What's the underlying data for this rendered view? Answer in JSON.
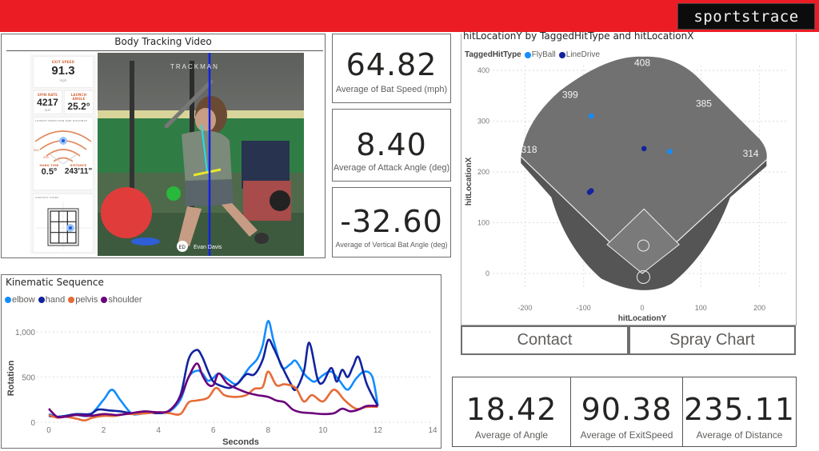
{
  "header": {
    "brand": "sportstrace",
    "brand_color": "#ec1c24"
  },
  "video": {
    "title": "Body Tracking Video",
    "overlay_brand": "TRACKMAN",
    "player_initials": "ED",
    "player_name": "Evan Davis",
    "trackman_card": {
      "exit_speed_label": "EXIT SPEED",
      "exit_speed": "91.3",
      "exit_speed_unit": "mph",
      "spin_rate_label": "SPIN RATE",
      "spin_rate": "4217",
      "spin_rate_unit": "rpm",
      "launch_angle_label": "LAUNCH ANGLE",
      "launch_angle": "25.2°",
      "direction_label": "LAUNCH DIRECTION AND DISTANCE",
      "ring_labels": [
        "300",
        "200",
        "100"
      ],
      "hang_time_label": "HANG TIME",
      "hang_time": "0.5°",
      "distance_label": "DISTANCE",
      "distance": "243'11\"",
      "contact_label": "CONTACT POINT"
    }
  },
  "kpis_top": [
    {
      "value": "64.82",
      "label": "Average of Bat Speed (mph)"
    },
    {
      "value": "8.40",
      "label": "Average of Attack Angle (deg)"
    },
    {
      "value": "-32.60",
      "label": "Average of Vertical Bat Angle (deg)"
    }
  ],
  "kpis_bottom": [
    {
      "value": "18.42",
      "label": "Average of Angle"
    },
    {
      "value": "90.38",
      "label": "Average of ExitSpeed"
    },
    {
      "value": "235.11",
      "label": "Average of Distance"
    }
  ],
  "tabs": [
    {
      "label": "Contact"
    },
    {
      "label": "Spray Chart"
    }
  ],
  "chart_data": [
    {
      "type": "line",
      "title": "Kinematic Sequence",
      "xlabel": "Seconds",
      "ylabel": "Rotation",
      "xlim": [
        0,
        14
      ],
      "ylim": [
        0,
        1000
      ],
      "xticks": [
        "0",
        "2",
        "4",
        "6",
        "8",
        "10",
        "12",
        "14"
      ],
      "yticks": [
        "0",
        "500",
        "1,000"
      ],
      "grid": true,
      "legend": "top-left",
      "series": [
        {
          "name": "elbow",
          "color": "#118dff",
          "x": [
            0,
            0.3,
            0.6,
            1.0,
            1.5,
            2.0,
            2.3,
            2.6,
            3.0,
            3.3,
            3.6,
            4.0,
            4.4,
            4.8,
            5.1,
            5.4,
            5.6,
            5.8,
            6.0,
            6.2,
            6.5,
            6.8,
            7.0,
            7.3,
            7.6,
            7.8,
            8.0,
            8.2,
            8.5,
            8.8,
            9.0,
            9.3,
            9.5,
            9.7,
            10.0,
            10.3,
            10.6,
            10.9,
            11.2,
            11.5,
            11.8,
            12.0
          ],
          "values": [
            90,
            60,
            70,
            80,
            80,
            250,
            360,
            250,
            100,
            90,
            110,
            100,
            120,
            250,
            500,
            570,
            540,
            460,
            490,
            540,
            480,
            420,
            470,
            600,
            700,
            850,
            1120,
            900,
            610,
            640,
            680,
            540,
            480,
            450,
            520,
            560,
            460,
            360,
            480,
            560,
            500,
            180
          ]
        },
        {
          "name": "hand",
          "color": "#12239e",
          "x": [
            0,
            0.3,
            0.6,
            1.0,
            1.5,
            1.8,
            2.2,
            2.6,
            3.0,
            3.3,
            3.6,
            4.0,
            4.4,
            4.8,
            5.1,
            5.4,
            5.6,
            5.8,
            6.0,
            6.3,
            6.6,
            6.9,
            7.2,
            7.5,
            7.8,
            8.0,
            8.2,
            8.5,
            8.8,
            9.0,
            9.3,
            9.5,
            9.8,
            10.0,
            10.3,
            10.5,
            10.7,
            10.9,
            11.1,
            11.3,
            11.6,
            12.0
          ],
          "values": [
            70,
            60,
            70,
            90,
            90,
            140,
            130,
            120,
            100,
            100,
            110,
            100,
            130,
            300,
            700,
            800,
            720,
            570,
            450,
            400,
            380,
            430,
            530,
            530,
            690,
            910,
            820,
            620,
            440,
            360,
            560,
            880,
            480,
            440,
            600,
            450,
            580,
            500,
            620,
            720,
            420,
            180
          ]
        },
        {
          "name": "pelvis",
          "color": "#e66c37",
          "x": [
            0,
            0.3,
            0.6,
            1.0,
            1.3,
            1.6,
            2.0,
            2.4,
            2.8,
            3.2,
            3.6,
            4.0,
            4.4,
            4.8,
            5.1,
            5.4,
            5.8,
            6.1,
            6.4,
            6.8,
            7.2,
            7.5,
            7.8,
            8.0,
            8.3,
            8.6,
            9.0,
            9.3,
            9.6,
            10.0,
            10.4,
            10.8,
            11.2,
            11.6,
            12.0
          ],
          "values": [
            80,
            50,
            60,
            40,
            20,
            50,
            70,
            70,
            90,
            90,
            100,
            110,
            100,
            90,
            220,
            240,
            270,
            380,
            300,
            280,
            300,
            370,
            390,
            560,
            410,
            420,
            380,
            230,
            300,
            230,
            360,
            240,
            150,
            170,
            170
          ]
        },
        {
          "name": "shoulder",
          "color": "#6b007b",
          "x": [
            0,
            0.3,
            0.6,
            1.0,
            1.5,
            2.0,
            2.5,
            3.0,
            3.5,
            4.0,
            4.4,
            4.8,
            5.1,
            5.4,
            5.6,
            5.8,
            6.0,
            6.2,
            6.5,
            6.8,
            7.2,
            7.6,
            8.0,
            8.3,
            8.6,
            8.9,
            9.2,
            9.6,
            10.0,
            10.4,
            10.7,
            11.0,
            11.3,
            11.6,
            12.0
          ],
          "values": [
            150,
            60,
            60,
            80,
            70,
            90,
            80,
            100,
            120,
            110,
            130,
            280,
            500,
            650,
            520,
            420,
            410,
            540,
            430,
            380,
            330,
            300,
            280,
            240,
            220,
            140,
            110,
            100,
            90,
            100,
            150,
            120,
            140,
            180,
            180
          ]
        }
      ]
    },
    {
      "type": "scatter",
      "title": "hitLocationY by TaggedHitType and hitLocationX",
      "xlabel": "hitLocationY",
      "ylabel": "hitLocationX",
      "xlim": [
        -220,
        220
      ],
      "ylim": [
        -40,
        420
      ],
      "xticks": [
        "-200",
        "-100",
        "0",
        "100",
        "200"
      ],
      "yticks": [
        "0",
        "100",
        "200",
        "300",
        "400"
      ],
      "grid": true,
      "legend_title": "TaggedHitType",
      "legend": "top-left",
      "field_distances": [
        "318",
        "399",
        "408",
        "385",
        "314"
      ],
      "series": [
        {
          "name": "FlyBall",
          "color": "#118dff",
          "points": [
            [
              -87,
              310
            ],
            [
              47,
              240
            ]
          ]
        },
        {
          "name": "LineDrive",
          "color": "#12239e",
          "points": [
            [
              3,
              246
            ],
            [
              -90,
              160
            ],
            [
              -87,
              163
            ]
          ]
        }
      ]
    }
  ]
}
